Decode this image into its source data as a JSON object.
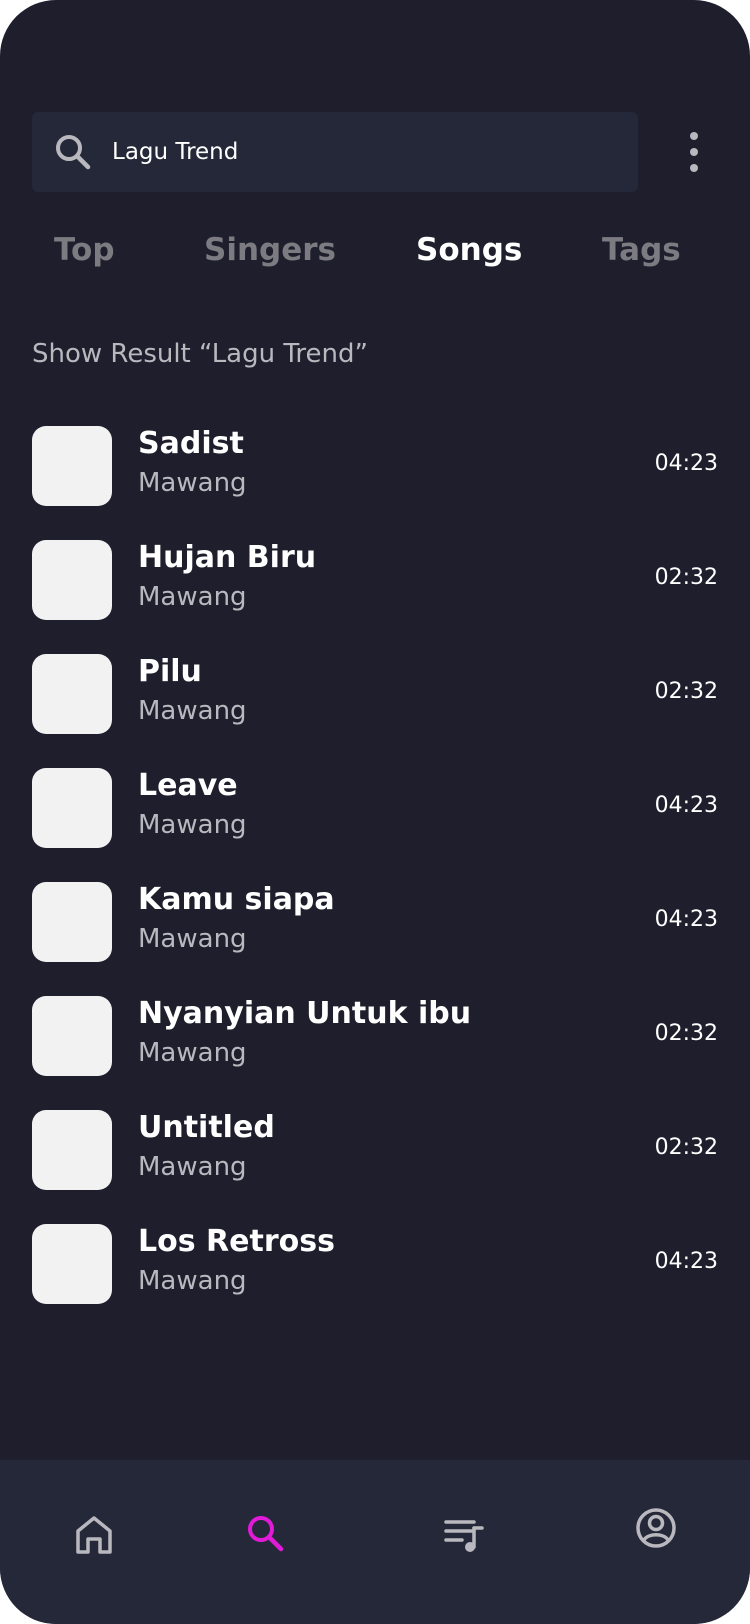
{
  "search": {
    "icon": "search-icon",
    "value": "Lagu Trend",
    "placeholder": "Search"
  },
  "menu": {
    "icon": "more-vertical-icon"
  },
  "tabs": [
    {
      "label": "Top",
      "active": false
    },
    {
      "label": "Singers",
      "active": false
    },
    {
      "label": "Songs",
      "active": true
    },
    {
      "label": "Tags",
      "active": false
    }
  ],
  "result_heading": "Show Result “Lagu Trend”",
  "songs": [
    {
      "title": "Sadist",
      "artist": "Mawang",
      "duration": "04:23"
    },
    {
      "title": "Hujan Biru",
      "artist": "Mawang",
      "duration": "02:32"
    },
    {
      "title": "Pilu",
      "artist": "Mawang",
      "duration": "02:32"
    },
    {
      "title": "Leave",
      "artist": "Mawang",
      "duration": "04:23"
    },
    {
      "title": "Kamu siapa",
      "artist": "Mawang",
      "duration": "04:23"
    },
    {
      "title": "Nyanyian Untuk ibu",
      "artist": "Mawang",
      "duration": "02:32"
    },
    {
      "title": "Untitled",
      "artist": "Mawang",
      "duration": "02:32"
    },
    {
      "title": "Los Retross",
      "artist": "Mawang",
      "duration": "04:23"
    }
  ],
  "bottom_nav": [
    {
      "icon": "home-icon",
      "active": false
    },
    {
      "icon": "search-icon",
      "active": true
    },
    {
      "icon": "playlist-icon",
      "active": false
    },
    {
      "icon": "profile-icon",
      "active": false
    }
  ],
  "colors": {
    "background": "#1f1e2c",
    "surface": "#252838",
    "accent": "#e21bd9",
    "text_primary": "#ffffff",
    "text_secondary": "#b9b8bf",
    "tab_inactive": "#7c7b82",
    "thumbnail": "#f2f2f2"
  }
}
